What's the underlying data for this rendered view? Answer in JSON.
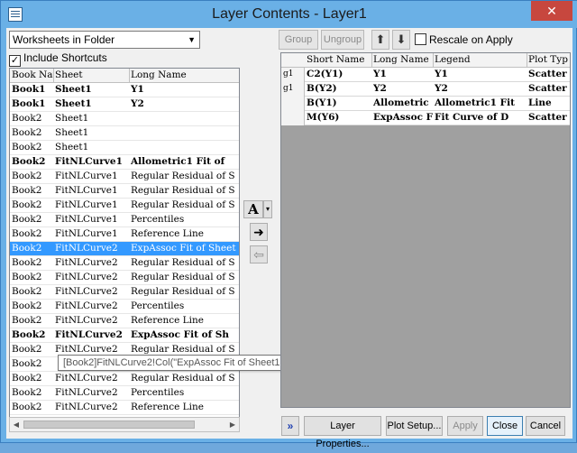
{
  "window": {
    "title": "Layer Contents - Layer1",
    "close_glyph": "✕"
  },
  "left": {
    "folder_select": {
      "value": "Worksheets in Folder"
    },
    "include_shortcuts": {
      "label": "Include Shortcuts",
      "checked": true
    },
    "columns": [
      "Book Nam",
      "Sheet",
      "Long Name"
    ],
    "rows": [
      {
        "book": "Book1",
        "sheet": "Sheet1",
        "long": "Y1",
        "bold": true
      },
      {
        "book": "Book1",
        "sheet": "Sheet1",
        "long": "Y2",
        "bold": true
      },
      {
        "book": "Book2",
        "sheet": "Sheet1",
        "long": "",
        "bold": false
      },
      {
        "book": "Book2",
        "sheet": "Sheet1",
        "long": "",
        "bold": false
      },
      {
        "book": "Book2",
        "sheet": "Sheet1",
        "long": "",
        "bold": false
      },
      {
        "book": "Book2",
        "sheet": "FitNLCurve1",
        "long": "Allometric1 Fit of",
        "bold": true
      },
      {
        "book": "Book2",
        "sheet": "FitNLCurve1",
        "long": "Regular Residual of S",
        "bold": false
      },
      {
        "book": "Book2",
        "sheet": "FitNLCurve1",
        "long": "Regular Residual of S",
        "bold": false
      },
      {
        "book": "Book2",
        "sheet": "FitNLCurve1",
        "long": "Regular Residual of S",
        "bold": false
      },
      {
        "book": "Book2",
        "sheet": "FitNLCurve1",
        "long": "Percentiles",
        "bold": false
      },
      {
        "book": "Book2",
        "sheet": "FitNLCurve1",
        "long": "Reference Line",
        "bold": false
      },
      {
        "book": "Book2",
        "sheet": "FitNLCurve2",
        "long": "ExpAssoc Fit of Sheet",
        "bold": false,
        "selected": true
      },
      {
        "book": "Book2",
        "sheet": "FitNLCurve2",
        "long": "Regular Residual of S",
        "bold": false
      },
      {
        "book": "Book2",
        "sheet": "FitNLCurve2",
        "long": "Regular Residual of S",
        "bold": false
      },
      {
        "book": "Book2",
        "sheet": "FitNLCurve2",
        "long": "Regular Residual of S",
        "bold": false
      },
      {
        "book": "Book2",
        "sheet": "FitNLCurve2",
        "long": "Percentiles",
        "bold": false
      },
      {
        "book": "Book2",
        "sheet": "FitNLCurve2",
        "long": "Reference Line",
        "bold": false
      },
      {
        "book": "Book2",
        "sheet": "FitNLCurve2",
        "long": "ExpAssoc Fit of Sh",
        "bold": true
      },
      {
        "book": "Book2",
        "sheet": "FitNLCurve2",
        "long": "Regular Residual of S",
        "bold": false
      },
      {
        "book": "Book2",
        "sheet": "",
        "long": "",
        "bold": false
      },
      {
        "book": "Book2",
        "sheet": "FitNLCurve2",
        "long": "Regular Residual of S",
        "bold": false
      },
      {
        "book": "Book2",
        "sheet": "FitNLCurve2",
        "long": "Percentiles",
        "bold": false
      },
      {
        "book": "Book2",
        "sheet": "FitNLCurve2",
        "long": "Reference Line",
        "bold": false
      }
    ]
  },
  "tooltip": "[Book2]FitNLCurve2!Col(\"ExpAssoc Fit of Sheet1 D\")",
  "middle": {
    "font_button": "A",
    "font_caret": "▾",
    "add_arrow": "➜",
    "remove_arrow": "⇦"
  },
  "toolbar": {
    "group": "Group",
    "ungroup": "Ungroup",
    "up": "⬆",
    "down": "⬇",
    "rescale": "Rescale on Apply"
  },
  "right": {
    "columns": [
      "Short Name",
      "Long Name",
      "Legend",
      "Plot Typ"
    ],
    "rows": [
      {
        "group": "g1",
        "short": "C2(Y1)",
        "long": "Y1",
        "legend": "Y1",
        "plot": "Scatter"
      },
      {
        "group": "g1",
        "short": "B(Y2)",
        "long": "Y2",
        "legend": "Y2",
        "plot": "Scatter"
      },
      {
        "group": "",
        "short": "B(Y1)",
        "long": "Allometric",
        "legend": "Allometric1 Fit",
        "plot": "Line"
      },
      {
        "group": "",
        "short": "M(Y6)",
        "long": "ExpAssoc F",
        "legend": "Fit Curve of D",
        "plot": "Scatter"
      }
    ]
  },
  "buttons": {
    "more": "»",
    "layer_properties": "Layer Properties...",
    "plot_setup": "Plot Setup...",
    "apply": "Apply",
    "close": "Close",
    "cancel": "Cancel"
  }
}
